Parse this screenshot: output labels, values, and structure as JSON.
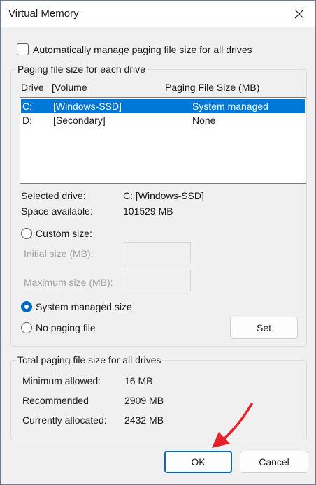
{
  "window": {
    "title": "Virtual Memory"
  },
  "auto_manage": {
    "label": "Automatically manage paging file size for all drives",
    "checked": false
  },
  "per_drive": {
    "group_label": "Paging file size for each drive",
    "columns": {
      "drive": "Drive",
      "volume": "[Volume",
      "size": "Paging File Size (MB)"
    },
    "rows": [
      {
        "drive": "C:",
        "volume": "[Windows-SSD]",
        "size": "System managed",
        "selected": true
      },
      {
        "drive": "D:",
        "volume": "[Secondary]",
        "size": "None",
        "selected": false
      }
    ],
    "selected_drive_label": "Selected drive:",
    "selected_drive_value": "C:  [Windows-SSD]",
    "space_available_label": "Space available:",
    "space_available_value": "101529 MB",
    "custom_size_label": "Custom size:",
    "initial_size_label": "Initial size (MB):",
    "maximum_size_label": "Maximum size (MB):",
    "system_managed_label": "System managed size",
    "no_paging_label": "No paging file",
    "selected_option": "system_managed",
    "set_button": "Set"
  },
  "totals": {
    "group_label": "Total paging file size for all drives",
    "minimum_label": "Minimum allowed:",
    "minimum_value": "16 MB",
    "recommended_label": "Recommended",
    "recommended_value": "2909 MB",
    "allocated_label": "Currently allocated:",
    "allocated_value": "2432 MB"
  },
  "buttons": {
    "ok": "OK",
    "cancel": "Cancel"
  },
  "icons": {
    "close": "close-icon",
    "annotation": "red-arrow-icon"
  },
  "colors": {
    "selection": "#0078d7",
    "accent": "#0067c0",
    "annotation": "#e8202a"
  }
}
